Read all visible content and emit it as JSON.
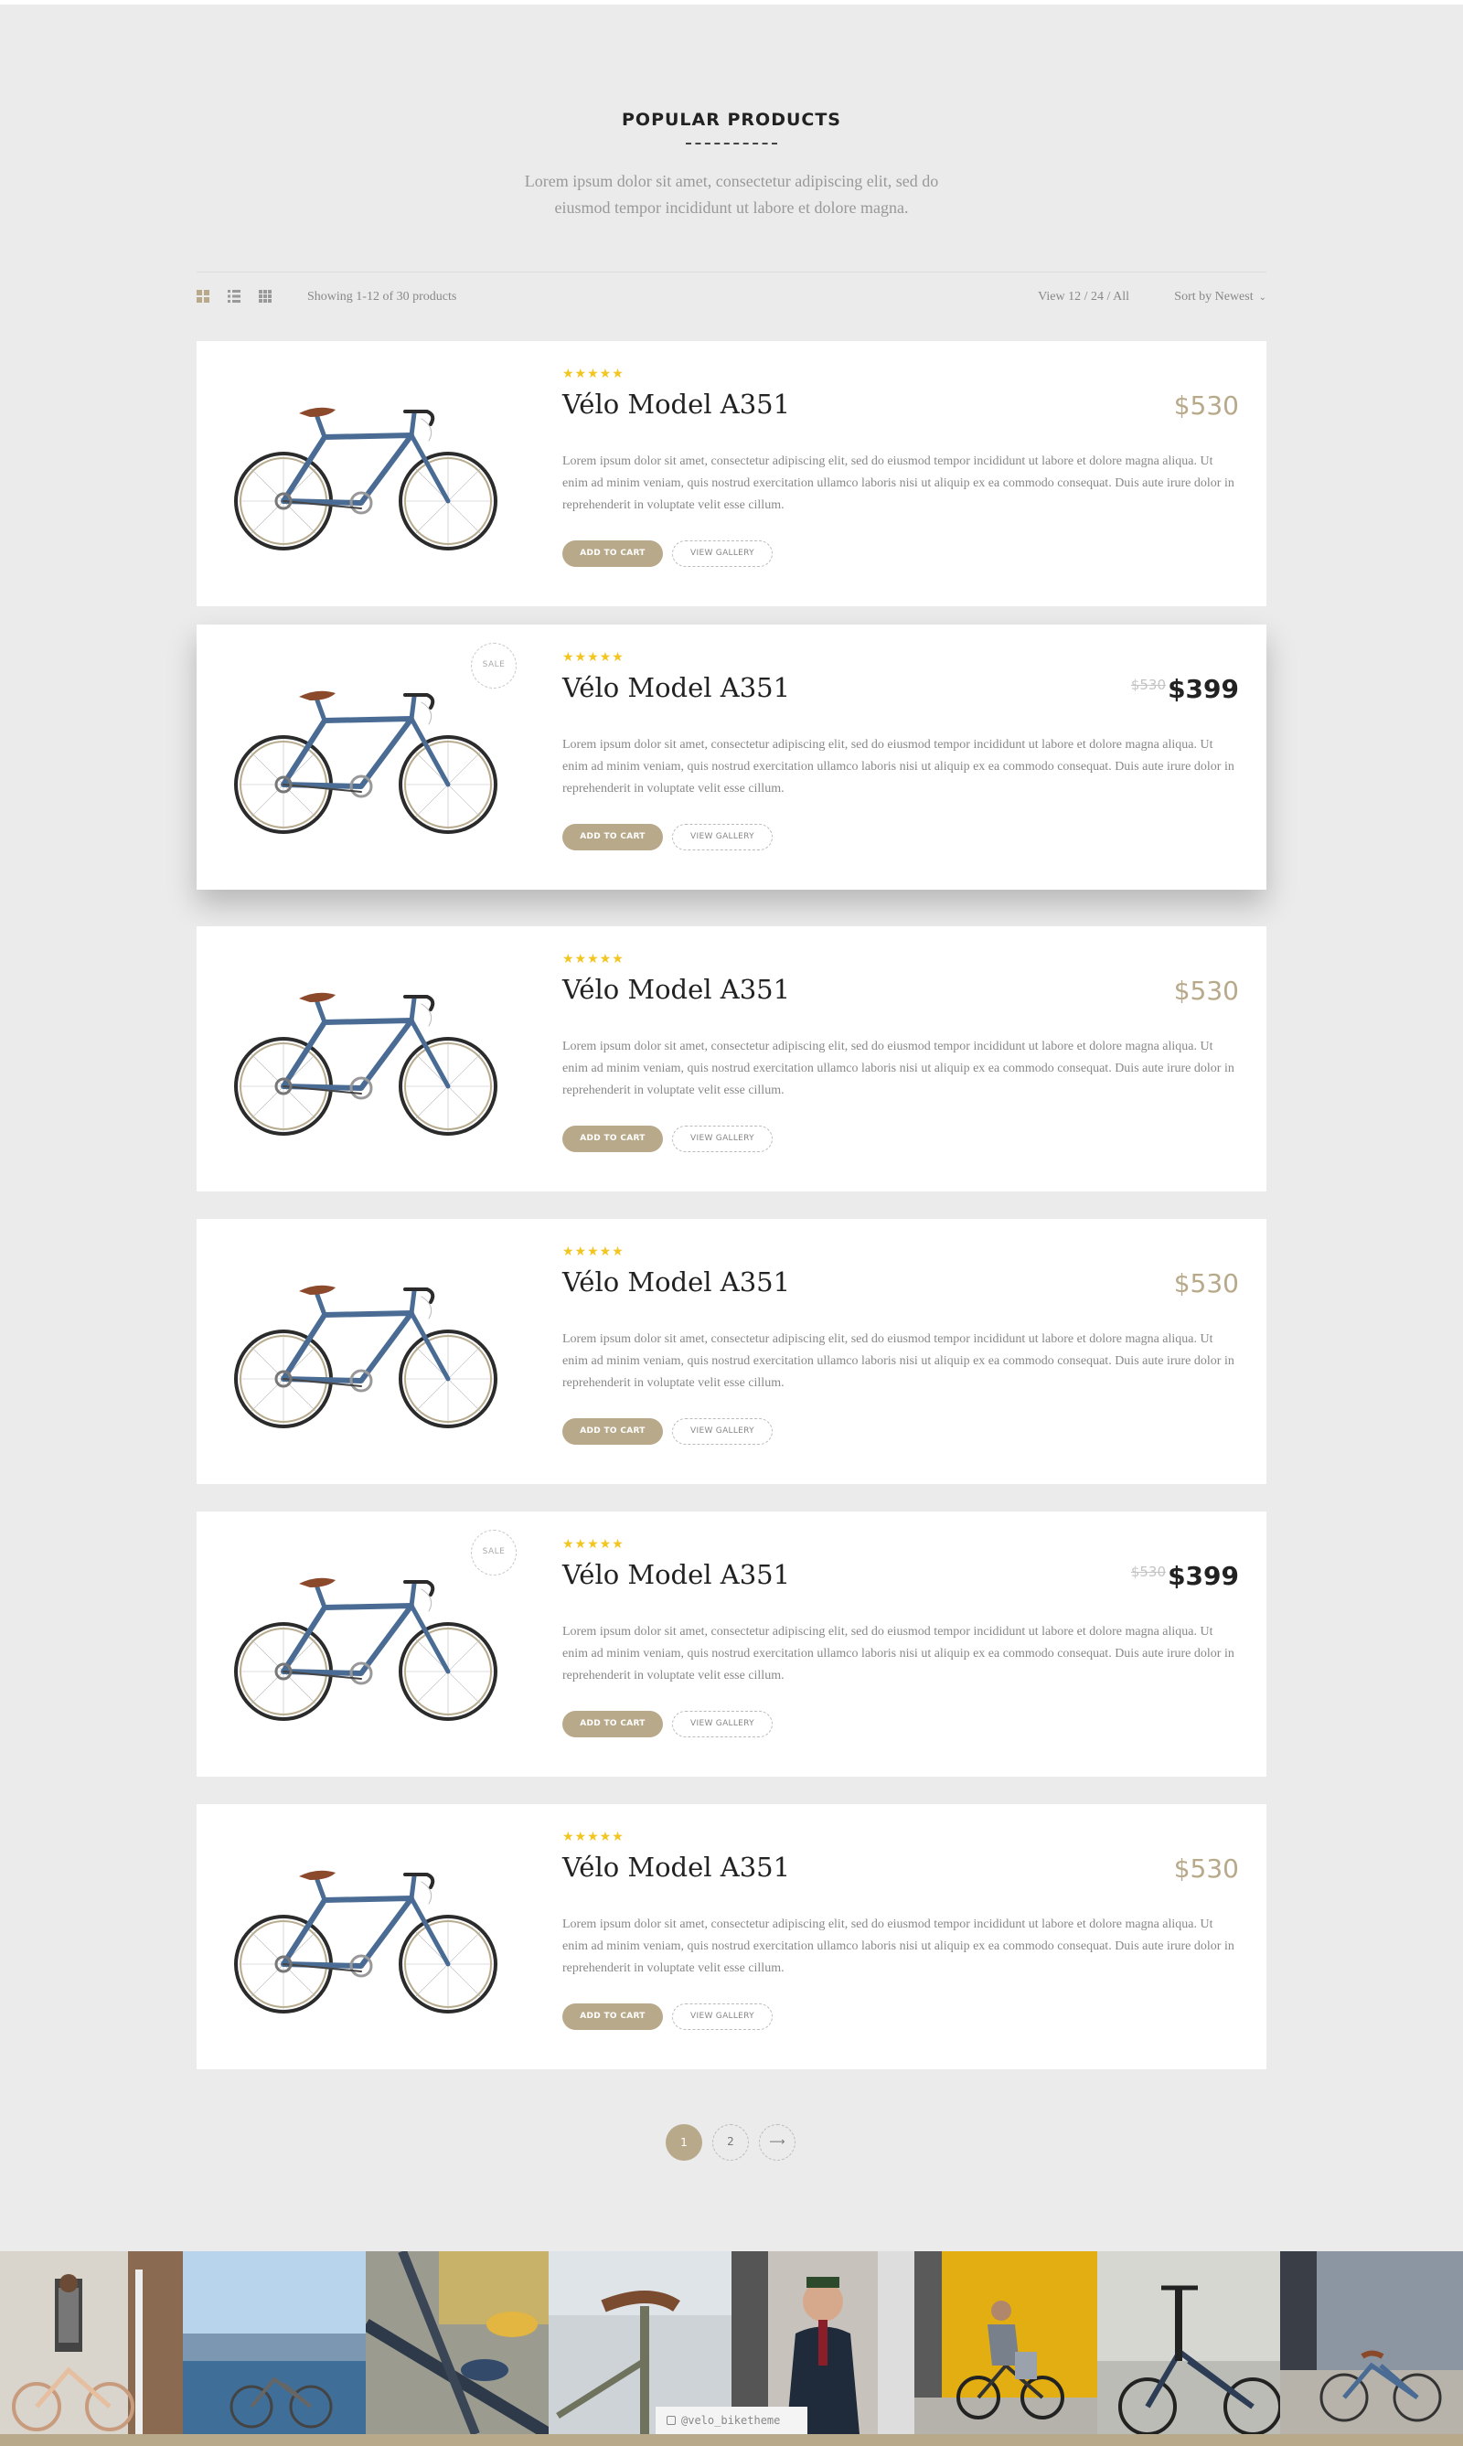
{
  "header": {
    "title": "POPULAR PRODUCTS",
    "subtitle_line1": "Lorem ipsum dolor sit amet, consectetur adipiscing elit, sed do",
    "subtitle_line2": "eiusmod tempor incididunt ut labore et dolore magna."
  },
  "toolbar": {
    "showing": "Showing 1-12 of 30 products",
    "view_12": "View 12",
    "sep1": " / ",
    "view_24": "24",
    "sep2": " / ",
    "view_all": "All",
    "sort_label": "Sort by Newest",
    "sort_chevron": "⌄",
    "view_icons": [
      "grid-view-icon",
      "list-view-icon",
      "small-grid-view-icon"
    ]
  },
  "products": [
    {
      "stars": "★★★★★",
      "name": "Vélo Model A351",
      "price": "$530",
      "old_price": "",
      "sale": false,
      "desc": "Lorem ipsum dolor sit amet, consectetur adipiscing elit, sed do eiusmod tempor incididunt ut labore et dolore magna aliqua. Ut enim ad minim veniam, quis nostrud exercitation ullamco laboris nisi ut aliquip ex ea commodo consequat. Duis aute irure dolor in reprehenderit in voluptate velit esse cillum.",
      "add_to_cart": "ADD TO CART",
      "view_gallery": "VIEW GALLERY"
    },
    {
      "stars": "★★★★★",
      "name": "Vélo Model A351",
      "price": "$399",
      "old_price": "$530",
      "sale": true,
      "sale_label": "SALE",
      "desc": "Lorem ipsum dolor sit amet, consectetur adipiscing elit, sed do eiusmod tempor incididunt ut labore et dolore magna aliqua. Ut enim ad minim veniam, quis nostrud exercitation ullamco laboris nisi ut aliquip ex ea commodo consequat. Duis aute irure dolor in reprehenderit in voluptate velit esse cillum.",
      "add_to_cart": "ADD TO CART",
      "view_gallery": "VIEW GALLERY"
    },
    {
      "stars": "★★★★★",
      "name": "Vélo Model A351",
      "price": "$530",
      "old_price": "",
      "sale": false,
      "desc": "Lorem ipsum dolor sit amet, consectetur adipiscing elit, sed do eiusmod tempor incididunt ut labore et dolore magna aliqua. Ut enim ad minim veniam, quis nostrud exercitation ullamco laboris nisi ut aliquip ex ea commodo consequat. Duis aute irure dolor in reprehenderit in voluptate velit esse cillum.",
      "add_to_cart": "ADD TO CART",
      "view_gallery": "VIEW GALLERY"
    },
    {
      "stars": "★★★★★",
      "name": "Vélo Model A351",
      "price": "$530",
      "old_price": "",
      "sale": false,
      "desc": "Lorem ipsum dolor sit amet, consectetur adipiscing elit, sed do eiusmod tempor incididunt ut labore et dolore magna aliqua. Ut enim ad minim veniam, quis nostrud exercitation ullamco laboris nisi ut aliquip ex ea commodo consequat. Duis aute irure dolor in reprehenderit in voluptate velit esse cillum.",
      "add_to_cart": "ADD TO CART",
      "view_gallery": "VIEW GALLERY"
    },
    {
      "stars": "★★★★★",
      "name": "Vélo Model A351",
      "price": "$399",
      "old_price": "$530",
      "sale": true,
      "sale_label": "SALE",
      "desc": "Lorem ipsum dolor sit amet, consectetur adipiscing elit, sed do eiusmod tempor incididunt ut labore et dolore magna aliqua. Ut enim ad minim veniam, quis nostrud exercitation ullamco laboris nisi ut aliquip ex ea commodo consequat. Duis aute irure dolor in reprehenderit in voluptate velit esse cillum.",
      "add_to_cart": "ADD TO CART",
      "view_gallery": "VIEW GALLERY"
    },
    {
      "stars": "★★★★★",
      "name": "Vélo Model A351",
      "price": "$530",
      "old_price": "",
      "sale": false,
      "desc": "Lorem ipsum dolor sit amet, consectetur adipiscing elit, sed do eiusmod tempor incididunt ut labore et dolore magna aliqua. Ut enim ad minim veniam, quis nostrud exercitation ullamco laboris nisi ut aliquip ex ea commodo consequat. Duis aute irure dolor in reprehenderit in voluptate velit esse cillum.",
      "add_to_cart": "ADD TO CART",
      "view_gallery": "VIEW GALLERY"
    }
  ],
  "pagination": {
    "page1": "1",
    "page2": "2",
    "next": "⟶"
  },
  "instagram": {
    "handle": "@velo_biketheme",
    "icon": "instagram-icon"
  },
  "colors": {
    "accent": "#b8a98a",
    "background": "#ebebeb",
    "star": "#f4c41f",
    "bike_frame": "#4a6c94"
  }
}
